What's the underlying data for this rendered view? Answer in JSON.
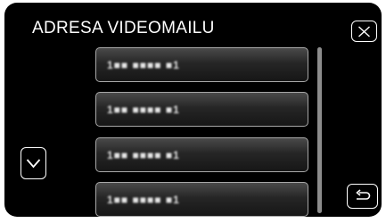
{
  "header": {
    "title": "ADRESA VIDEOMAILU"
  },
  "toolbar": {
    "close_icon": "close-icon",
    "scroll_down_icon": "chevron-down-icon",
    "back_icon": "return-arrow-icon"
  },
  "list": {
    "items": [
      {
        "value": "1■■ ■■■■ ■1"
      },
      {
        "value": "1■■ ■■■■ ■1"
      },
      {
        "value": "1■■ ■■■■ ■1"
      },
      {
        "value": "1■■ ■■■■ ■1"
      }
    ]
  },
  "colors": {
    "background": "#000000",
    "button_border": "#ffffff",
    "item_border": "#a8a8a8"
  }
}
